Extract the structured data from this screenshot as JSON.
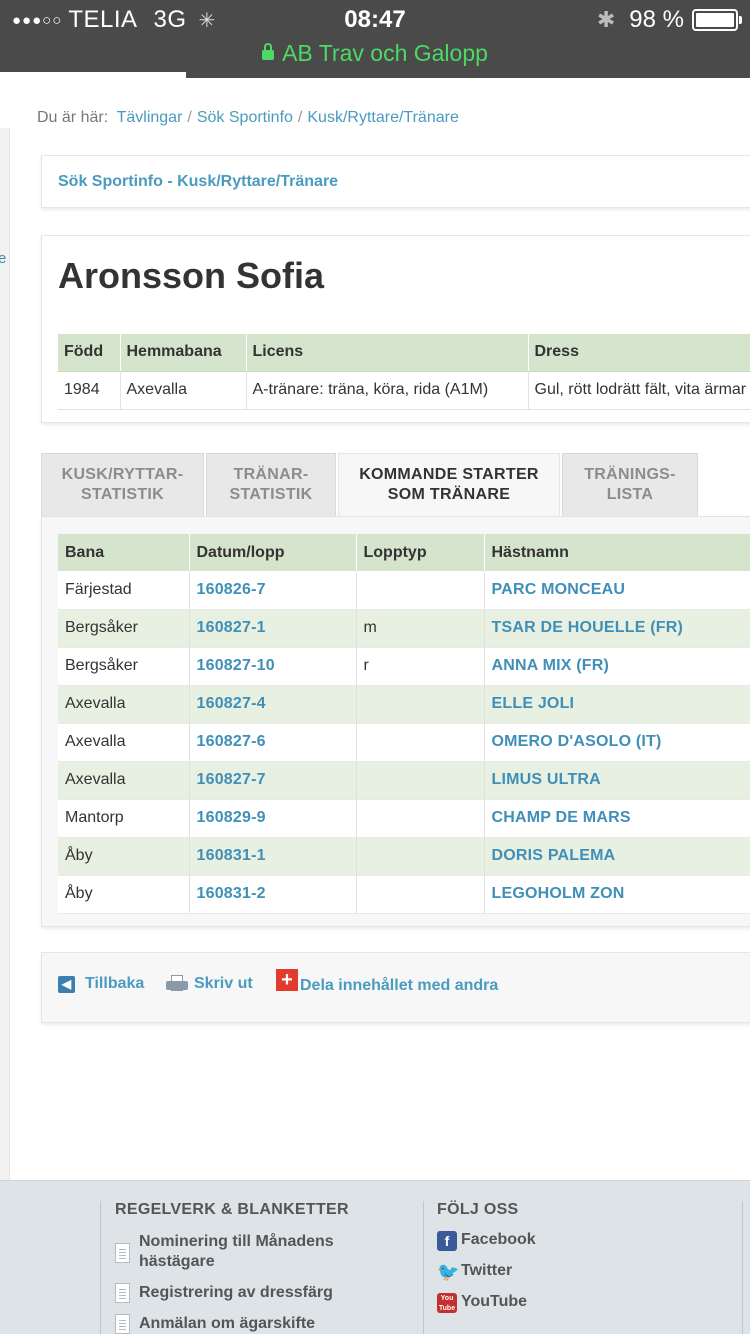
{
  "status": {
    "carrier": "TELIA",
    "network": "3G",
    "time": "08:47",
    "battery": "98 %",
    "signal_dots": "●●●○○"
  },
  "browser": {
    "url_title": "AB Trav och Galopp"
  },
  "breadcrumb": {
    "prefix": "Du är här:",
    "items": [
      "Tävlingar",
      "Sök Sportinfo",
      "Kusk/Ryttare/Tränare"
    ]
  },
  "search_box": {
    "title": "Sök Sportinfo - Kusk/Ryttare/Tränare"
  },
  "left_rail": {
    "char": "e"
  },
  "person": {
    "name": "Aronsson Sofia",
    "headers": [
      "Född",
      "Hemmabana",
      "Licens",
      "Dress"
    ],
    "values": [
      "1984",
      "Axevalla",
      "A-tränare: träna, köra, rida (A1M)",
      "Gul, rött lodrätt fält, vita ärmar"
    ]
  },
  "tabs": [
    {
      "line1": "KUSK/RYTTAR-",
      "line2": "STATISTIK"
    },
    {
      "line1": "TRÄNAR-",
      "line2": "STATISTIK"
    },
    {
      "line1": "KOMMANDE STARTER",
      "line2": "SOM TRÄNARE"
    },
    {
      "line1": "TRÄNINGS-",
      "line2": "LISTA"
    }
  ],
  "starts": {
    "headers": [
      "Bana",
      "Datum/lopp",
      "Lopptyp",
      "Hästnamn"
    ],
    "rows": [
      {
        "bana": "Färjestad",
        "datum": "160826-7",
        "typ": "",
        "hast": "PARC MONCEAU"
      },
      {
        "bana": "Bergsåker",
        "datum": "160827-1",
        "typ": "m",
        "hast": "TSAR DE HOUELLE (FR)"
      },
      {
        "bana": "Bergsåker",
        "datum": "160827-10",
        "typ": "r",
        "hast": "ANNA MIX (FR)"
      },
      {
        "bana": "Axevalla",
        "datum": "160827-4",
        "typ": "",
        "hast": "ELLE JOLI"
      },
      {
        "bana": "Axevalla",
        "datum": "160827-6",
        "typ": "",
        "hast": "OMERO D'ASOLO (IT)"
      },
      {
        "bana": "Axevalla",
        "datum": "160827-7",
        "typ": "",
        "hast": "LIMUS ULTRA"
      },
      {
        "bana": "Mantorp",
        "datum": "160829-9",
        "typ": "",
        "hast": "CHAMP DE MARS"
      },
      {
        "bana": "Åby",
        "datum": "160831-1",
        "typ": "",
        "hast": "DORIS PALEMA"
      },
      {
        "bana": "Åby",
        "datum": "160831-2",
        "typ": "",
        "hast": "LEGOHOLM ZON"
      }
    ]
  },
  "actions": {
    "back": "Tillbaka",
    "print": "Skriv ut",
    "share": "Dela innehållet med andra"
  },
  "footer": {
    "col1_title": "REGELVERK & BLANKETTER",
    "col1_items": [
      "Nominering till Månadens hästägare",
      "Registrering av dressfärg",
      "Anmälan om ägarskifte"
    ],
    "col2_title": "FÖLJ OSS",
    "col2_items": [
      "Facebook",
      "Twitter",
      "YouTube"
    ]
  },
  "icons": {
    "youtube_top": "You",
    "youtube_bottom": "Tube"
  }
}
